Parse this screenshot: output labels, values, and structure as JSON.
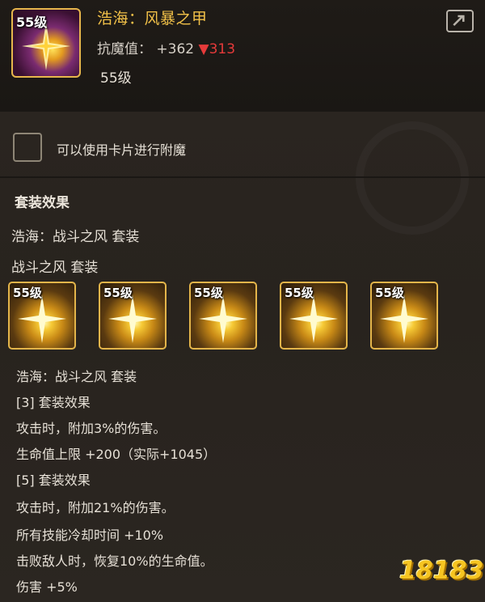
{
  "item": {
    "icon_level": "55级",
    "name": "浩海：风暴之甲",
    "stat_label": "抗魔值：",
    "stat_value": "+362",
    "stat_change_symbol": "▼",
    "stat_change": "313",
    "level": "55级"
  },
  "enchant": {
    "label": "可以使用卡片进行附魔"
  },
  "set": {
    "title": "套装效果",
    "line1": "浩海：战斗之风 套装",
    "line2": "战斗之风 套装",
    "slots": [
      {
        "level": "55级"
      },
      {
        "level": "55级"
      },
      {
        "level": "55级"
      },
      {
        "level": "55级"
      },
      {
        "level": "55级"
      }
    ],
    "details": [
      "浩海：战斗之风 套装",
      "[3] 套装效果",
      "攻击时，附加3%的伤害。",
      "生命值上限 +200（实际+1045）",
      "[5] 套装效果",
      "攻击时，附加21%的伤害。",
      "所有技能冷却时间 +10%",
      "击败敌人时，恢复10%的生命值。",
      "伤害 +5%"
    ]
  },
  "watermark": {
    "text": "18183"
  },
  "colors": {
    "gold": "#f1c048",
    "down_red": "#e63a3a",
    "background": "#231f1b"
  }
}
